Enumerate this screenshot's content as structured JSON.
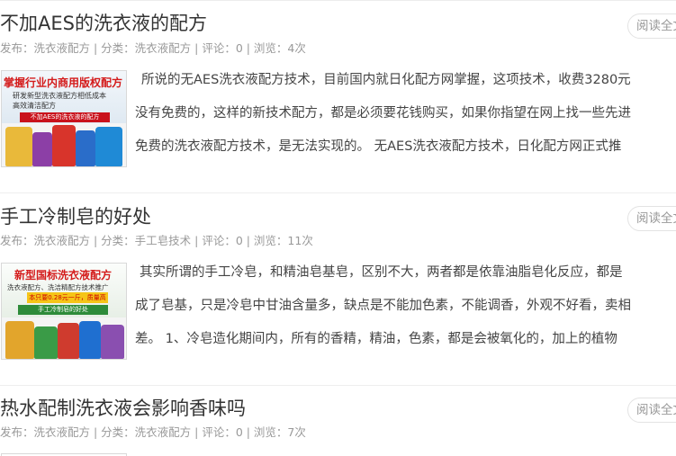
{
  "articles": [
    {
      "title": "不加AES的洗衣液的配方",
      "meta": "发布：洗衣液配方 | 分类：洗衣液配方 | 评论：0 | 浏览：4次",
      "read_label": "阅读全文",
      "thumb": {
        "headline": "掌握行业内商用版权配方",
        "lines": [
          "研发新型洗衣液配方相低成本",
          "高效清洁配方"
        ],
        "ribbon": "不加AES的洗衣液的配方"
      },
      "excerpt": [
        "所说的无AES洗衣液配方技术，目前国内就日化配方网掌握，这项技术，收费3280元",
        "没有免费的，这样的新技术配方，都是必须要花钱购买，如果你指望在网上找一些先进",
        "免费的洗衣液配方技术，是无法实现的。 无AES洗衣液配方技术，日化配方网正式推"
      ]
    },
    {
      "title": "手工冷制皂的好处",
      "meta": "发布：洗衣液配方 | 分类：手工皂技术 | 评论：0 | 浏览：11次",
      "read_label": "阅读全文",
      "thumb": {
        "headline": "新型国标洗衣液配方",
        "lines": [
          "洗衣液配方、洗洁精配方技术推广"
        ],
        "yellow": "本只要0.28元一斤，质量高",
        "ribbon": "手工冷制皂的好处"
      },
      "excerpt": [
        "其实所谓的手工冷皂，和精油皂基皂，区别不大，两者都是依靠油脂皂化反应，都是",
        "成了皂基，只是冷皂中甘油含量多，缺点是不能加色素，不能调香，外观不好看，卖相",
        "差。 1、冷皂造化期间内，所有的香精，精油，色素，都是会被氧化的，加上的植物"
      ]
    },
    {
      "title": "热水配制洗衣液会影响香味吗",
      "meta": "发布：洗衣液配方 | 分类：洗衣液配方 | 评论：0 | 浏览：7次",
      "read_label": "阅读全文"
    }
  ]
}
